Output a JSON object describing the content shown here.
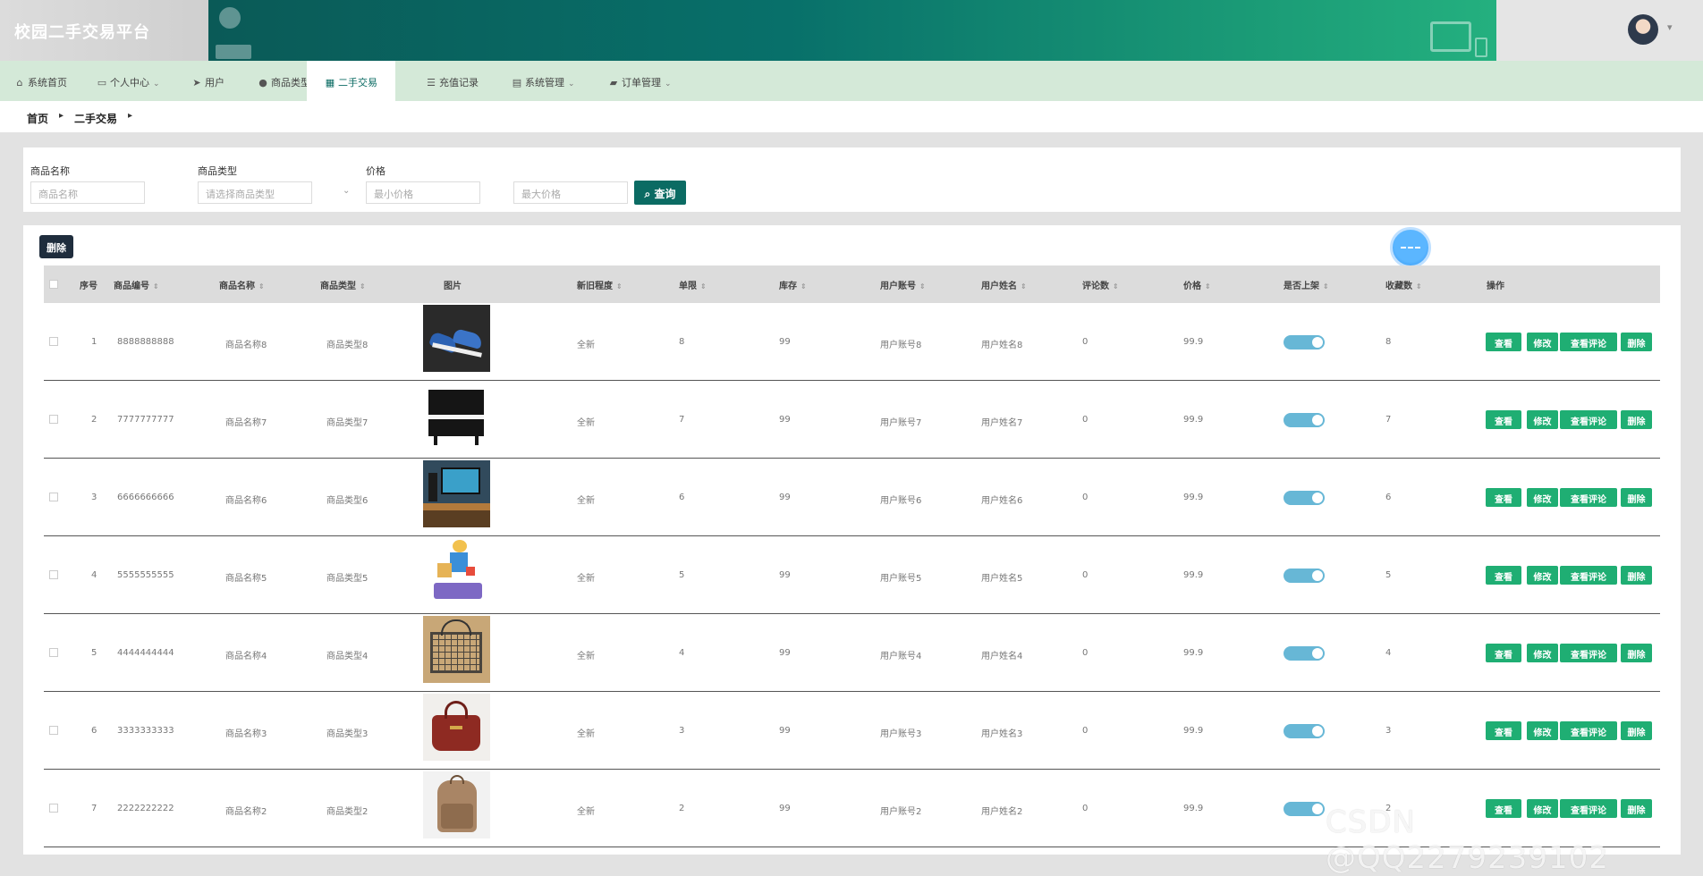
{
  "app": {
    "title": "校园二手交易平台"
  },
  "nav": [
    {
      "label": "系统首页",
      "icon": "home-icon",
      "glyph": "⌂",
      "caret": false
    },
    {
      "label": "个人中心",
      "icon": "id-card-icon",
      "glyph": "▭",
      "caret": true
    },
    {
      "label": "用户",
      "icon": "send-icon",
      "glyph": "➤",
      "caret": false
    },
    {
      "label": "商品类型",
      "icon": "user-icon",
      "glyph": "●",
      "caret": false
    },
    {
      "label": "二手交易",
      "icon": "grid-icon",
      "glyph": "▦",
      "caret": false,
      "active": true
    },
    {
      "label": "充值记录",
      "icon": "list-icon",
      "glyph": "☰",
      "caret": false
    },
    {
      "label": "系统管理",
      "icon": "clipboard-icon",
      "glyph": "▤",
      "caret": true
    },
    {
      "label": "订单管理",
      "icon": "truck-icon",
      "glyph": "▰",
      "caret": true
    }
  ],
  "breadcrumb": [
    "首页",
    "二手交易"
  ],
  "search": {
    "name_label": "商品名称",
    "name_placeholder": "商品名称",
    "type_label": "商品类型",
    "type_placeholder": "请选择商品类型",
    "price_label": "价格",
    "min_placeholder": "最小价格",
    "max_placeholder": "最大价格",
    "query_button": "查询"
  },
  "toolbar": {
    "delete_button": "删除"
  },
  "table": {
    "columns": [
      "序号",
      "商品编号",
      "商品名称",
      "商品类型",
      "图片",
      "新旧程度",
      "单限",
      "库存",
      "用户账号",
      "用户姓名",
      "评论数",
      "价格",
      "是否上架",
      "收藏数",
      "操作"
    ],
    "actions": [
      "查看",
      "修改",
      "查看评论",
      "删除"
    ],
    "rows": [
      {
        "no": "1",
        "code": "8888888888",
        "name": "商品名称8",
        "type": "商品类型8",
        "image": "sneakers",
        "condition": "全新",
        "limit": "8",
        "stock": "99",
        "account": "用户账号8",
        "username": "用户姓名8",
        "comments": "0",
        "price": "99.9",
        "listed": true,
        "favorites": "8"
      },
      {
        "no": "2",
        "code": "7777777777",
        "name": "商品名称7",
        "type": "商品类型7",
        "image": "piano",
        "condition": "全新",
        "limit": "7",
        "stock": "99",
        "account": "用户账号7",
        "username": "用户姓名7",
        "comments": "0",
        "price": "99.9",
        "listed": true,
        "favorites": "7"
      },
      {
        "no": "3",
        "code": "6666666666",
        "name": "商品名称6",
        "type": "商品类型6",
        "image": "computer-desk",
        "condition": "全新",
        "limit": "6",
        "stock": "99",
        "account": "用户账号6",
        "username": "用户姓名6",
        "comments": "0",
        "price": "99.9",
        "listed": true,
        "favorites": "6"
      },
      {
        "no": "4",
        "code": "5555555555",
        "name": "商品名称5",
        "type": "商品类型5",
        "image": "toy",
        "condition": "全新",
        "limit": "5",
        "stock": "99",
        "account": "用户账号5",
        "username": "用户姓名5",
        "comments": "0",
        "price": "99.9",
        "listed": true,
        "favorites": "5"
      },
      {
        "no": "5",
        "code": "4444444444",
        "name": "商品名称4",
        "type": "商品类型4",
        "image": "wire-basket",
        "condition": "全新",
        "limit": "4",
        "stock": "99",
        "account": "用户账号4",
        "username": "用户姓名4",
        "comments": "0",
        "price": "99.9",
        "listed": true,
        "favorites": "4"
      },
      {
        "no": "6",
        "code": "3333333333",
        "name": "商品名称3",
        "type": "商品类型3",
        "image": "handbag",
        "condition": "全新",
        "limit": "3",
        "stock": "99",
        "account": "用户账号3",
        "username": "用户姓名3",
        "comments": "0",
        "price": "99.9",
        "listed": true,
        "favorites": "3"
      },
      {
        "no": "7",
        "code": "2222222222",
        "name": "商品名称2",
        "type": "商品类型2",
        "image": "backpack",
        "condition": "全新",
        "limit": "2",
        "stock": "99",
        "account": "用户账号2",
        "username": "用户姓名2",
        "comments": "0",
        "price": "99.9",
        "listed": true,
        "favorites": "2"
      }
    ]
  },
  "watermark": "CSDN @QQ2279239102",
  "colors": {
    "primary": "#0b6b63",
    "action": "#1fae73",
    "nav_bg": "#d4e9d8",
    "toggle_on": "#67b7d6"
  }
}
